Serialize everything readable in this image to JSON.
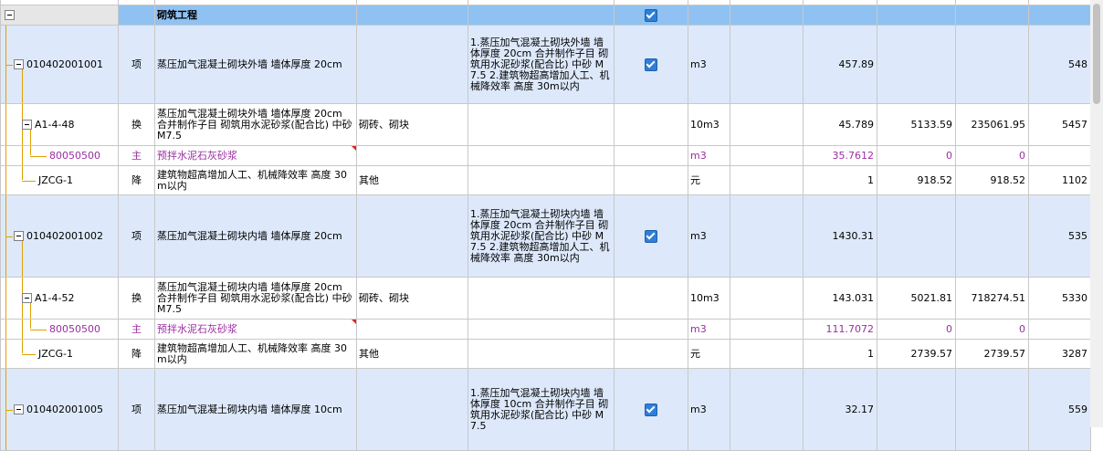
{
  "section": {
    "name": "砌筑工程"
  },
  "rows": [
    {
      "code": "010402001001",
      "type": "项",
      "name": "蒸压加气混凝土砌块外墙 墙体厚度 20cm",
      "spec": "",
      "desc": "1.蒸压加气混凝土砌块外墙 墙体厚度 20cm 合并制作子目 砌筑用水泥砂浆(配合比) 中砂 M7.5 2.建筑物超高增加人工、机械降效率 高度 30m以内",
      "unit": "m3",
      "qty": "457.89",
      "price": "",
      "total": "",
      "last": "548"
    },
    {
      "code": "A1-4-48",
      "type": "换",
      "name": "蒸压加气混凝土砌块外墙 墙体厚度 20cm 合并制作子目 砌筑用水泥砂浆(配合比) 中砂 M7.5",
      "spec": "砌砖、砌块",
      "desc": "",
      "unit": "10m3",
      "qty": "45.789",
      "price": "5133.59",
      "total": "235061.95",
      "last": "5457"
    },
    {
      "code": "80050500",
      "type": "主",
      "name": "预拌水泥石灰砂浆",
      "spec": "",
      "desc": "",
      "unit": "m3",
      "qty": "35.7612",
      "price": "0",
      "total": "0",
      "last": ""
    },
    {
      "code": "JZCG-1",
      "type": "降",
      "name": "建筑物超高增加人工、机械降效率 高度 30m以内",
      "spec": "其他",
      "desc": "",
      "unit": "元",
      "qty": "1",
      "price": "918.52",
      "total": "918.52",
      "last": "1102"
    },
    {
      "code": "010402001002",
      "type": "项",
      "name": "蒸压加气混凝土砌块内墙 墙体厚度 20cm",
      "spec": "",
      "desc": "1.蒸压加气混凝土砌块内墙 墙体厚度 20cm 合并制作子目 砌筑用水泥砂浆(配合比) 中砂 M7.5 2.建筑物超高增加人工、机械降效率 高度 30m以内",
      "unit": "m3",
      "qty": "1430.31",
      "price": "",
      "total": "",
      "last": "535"
    },
    {
      "code": "A1-4-52",
      "type": "换",
      "name": "蒸压加气混凝土砌块内墙 墙体厚度 20cm 合并制作子目 砌筑用水泥砂浆(配合比) 中砂 M7.5",
      "spec": "砌砖、砌块",
      "desc": "",
      "unit": "10m3",
      "qty": "143.031",
      "price": "5021.81",
      "total": "718274.51",
      "last": "5330"
    },
    {
      "code": "80050500",
      "type": "主",
      "name": "预拌水泥石灰砂浆",
      "spec": "",
      "desc": "",
      "unit": "m3",
      "qty": "111.7072",
      "price": "0",
      "total": "0",
      "last": ""
    },
    {
      "code": "JZCG-1",
      "type": "降",
      "name": "建筑物超高增加人工、机械降效率 高度 30m以内",
      "spec": "其他",
      "desc": "",
      "unit": "元",
      "qty": "1",
      "price": "2739.57",
      "total": "2739.57",
      "last": "3287"
    },
    {
      "code": "010402001005",
      "type": "项",
      "name": "蒸压加气混凝土砌块内墙 墙体厚度 10cm",
      "spec": "",
      "desc": "1.蒸压加气混凝土砌块内墙 墙体厚度 10cm 合并制作子目 砌筑用水泥砂浆(配合比) 中砂 M7.5",
      "unit": "m3",
      "qty": "32.17",
      "price": "",
      "total": "",
      "last": "559"
    }
  ],
  "colors": {
    "section_bg": "#8fc2f2",
    "item_bg": "#dde9fb",
    "main_material_text": "#9b2ea1",
    "tree_line": "#e0a000",
    "checkbox": "#2f7fd9"
  },
  "icons": {
    "collapse": "minus-box-icon",
    "checked": "checkbox-checked-icon",
    "flag": "red-corner-flag-icon"
  }
}
